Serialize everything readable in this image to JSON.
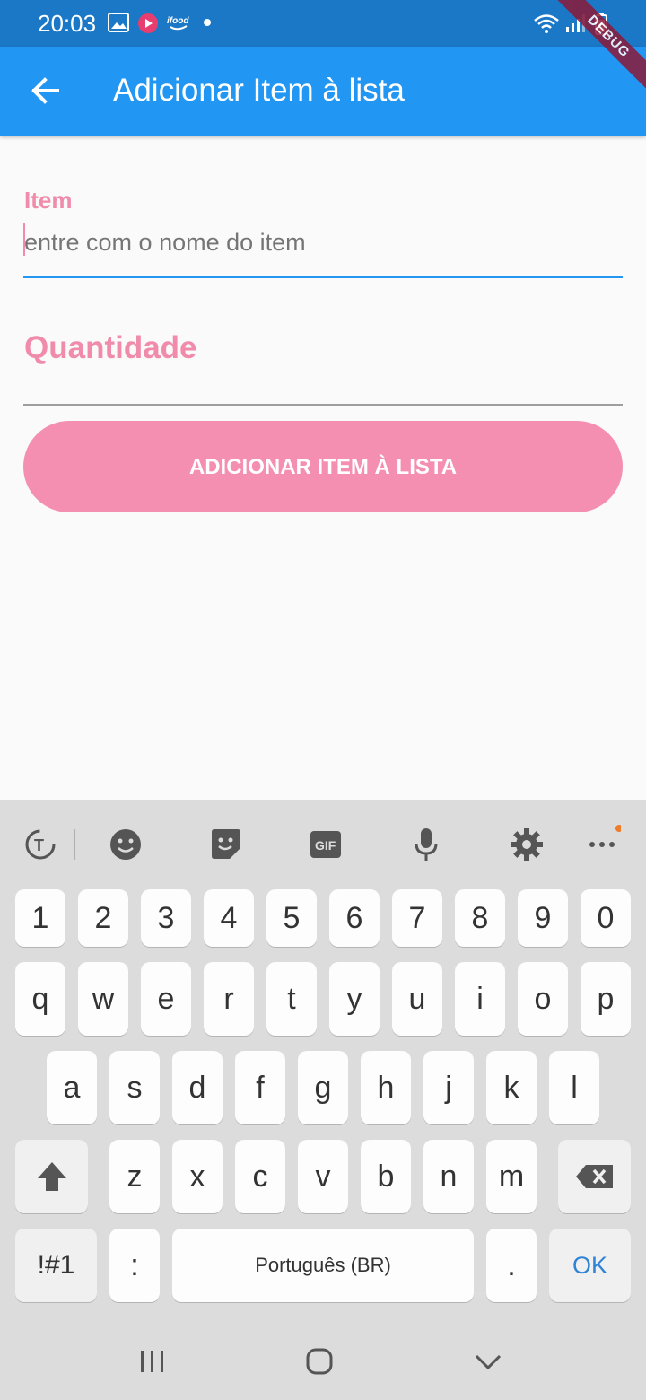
{
  "status_bar": {
    "time": "20:03"
  },
  "app_bar": {
    "title": "Adicionar Item à lista",
    "debug_banner": "DEBUG"
  },
  "form": {
    "item_label": "Item",
    "item_placeholder": "entre com o nome do item",
    "quantity_label": "Quantidade",
    "submit_label": "ADICIONAR ITEM À LISTA"
  },
  "keyboard": {
    "numbers": [
      "1",
      "2",
      "3",
      "4",
      "5",
      "6",
      "7",
      "8",
      "9",
      "0"
    ],
    "row1": [
      "q",
      "w",
      "e",
      "r",
      "t",
      "y",
      "u",
      "i",
      "o",
      "p"
    ],
    "row2": [
      "a",
      "s",
      "d",
      "f",
      "g",
      "h",
      "j",
      "k",
      "l"
    ],
    "row3": [
      "z",
      "x",
      "c",
      "v",
      "b",
      "n",
      "m"
    ],
    "symbols_label": "!#1",
    "colon_label": ":",
    "space_label": "Português (BR)",
    "period_label": ".",
    "ok_label": "OK"
  },
  "colors": {
    "app_bar": "#2196f3",
    "status_bar": "#1b78c6",
    "accent_pink": "#f48fb1",
    "label_pink": "#f08bab"
  }
}
